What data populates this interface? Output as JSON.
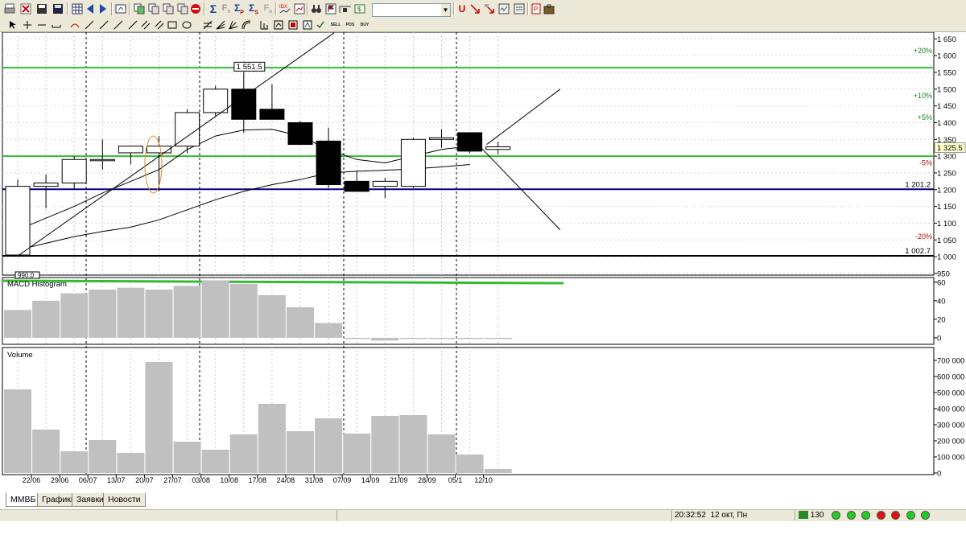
{
  "toolbar": {
    "icons": [
      "print-icon",
      "stop-icon",
      "save-icon",
      "chart-icon",
      "back-icon",
      "forward-icon",
      "refresh-icon",
      "copy-icon",
      "copy2-icon",
      "copy3-icon",
      "copy4-icon",
      "stop-sign-icon",
      "sum-icon",
      "fx-icon",
      "sigma-p-icon",
      "sigma-s-icon",
      "fa-icon",
      "index-icon",
      "chart2-icon",
      "binoculars-icon",
      "flag-icon",
      "tick-icon",
      "usd-icon",
      "arrow-icon",
      "report-icon",
      "book-icon",
      "briefcase-icon"
    ],
    "combo_value": "",
    "tools": [
      "cursor-icon",
      "crosshair-icon",
      "hline-icon",
      "line-icon",
      "ray-icon",
      "trend-icon",
      "channel-icon",
      "rect-icon",
      "ellipse-icon",
      "text-icon",
      "fib-icon",
      "fan-icon",
      "arc-icon",
      "time-icon",
      "zoom-icon",
      "buy-icon",
      "sell-icon",
      "sell-tag",
      "pos-tag",
      "av-tag"
    ],
    "tag_sell": "SELL",
    "tag_pos": "POS",
    "tag_buy": "BUY"
  },
  "colors": {
    "green": "#33bb33",
    "navy": "#000080",
    "panel_bg": "#ece9d8",
    "bar_gray": "#c0c0c0"
  },
  "chart_data": [
    {
      "type": "candlestick",
      "title": "",
      "categories": [
        "22/06",
        "29/06",
        "06/07",
        "13/07",
        "20/07",
        "27/07",
        "03/08",
        "10/08",
        "17/08",
        "24/08",
        "31/08",
        "07/09",
        "14/09",
        "21/09",
        "28/09",
        "05/10",
        "12/10",
        "",
        "",
        ""
      ],
      "x_tick_labels": [
        "22/06",
        "29/06",
        "06/07",
        "13/07",
        "20/07",
        "27/07",
        "03/08",
        "10/08",
        "17/08",
        "24/08",
        "31/08",
        "07/09",
        "14/09",
        "21/09",
        "28/09",
        "05/1",
        "12/10"
      ],
      "candles": [
        {
          "o": 1005,
          "h": 1230,
          "l": 1005,
          "c": 1210
        },
        {
          "o": 1210,
          "h": 1245,
          "l": 1145,
          "c": 1220
        },
        {
          "o": 1220,
          "h": 1300,
          "l": 1200,
          "c": 1290
        },
        {
          "o": 1290,
          "h": 1350,
          "l": 1260,
          "c": 1290
        },
        {
          "o": 1310,
          "h": 1330,
          "l": 1275,
          "c": 1330
        },
        {
          "o": 1310,
          "h": 1360,
          "l": 1195,
          "c": 1330
        },
        {
          "o": 1330,
          "h": 1440,
          "l": 1310,
          "c": 1430
        },
        {
          "o": 1430,
          "h": 1510,
          "l": 1420,
          "c": 1500
        },
        {
          "o": 1500,
          "h": 1551.5,
          "l": 1370,
          "c": 1410
        },
        {
          "o": 1440,
          "h": 1515,
          "l": 1410,
          "c": 1410
        },
        {
          "o": 1400,
          "h": 1405,
          "l": 1340,
          "c": 1335
        },
        {
          "o": 1345,
          "h": 1385,
          "l": 1205,
          "c": 1215
        },
        {
          "o": 1225,
          "h": 1255,
          "l": 1195,
          "c": 1195
        },
        {
          "o": 1210,
          "h": 1235,
          "l": 1175,
          "c": 1225
        },
        {
          "o": 1210,
          "h": 1355,
          "l": 1205,
          "c": 1350
        },
        {
          "o": 1350,
          "h": 1380,
          "l": 1325,
          "c": 1355
        },
        {
          "o": 1370,
          "h": 1370,
          "l": 1310,
          "c": 1315
        },
        {
          "o": 1320,
          "h": 1342,
          "l": 1305,
          "c": 1328
        }
      ],
      "y_ticks": [
        "1 650",
        "1 600",
        "1 550",
        "1 500",
        "1 450",
        "1 400",
        "1 350",
        "1 300",
        "1 250",
        "1 200",
        "1 150",
        "1 100",
        "1 050",
        "1 000",
        "950"
      ],
      "y_tick_values": [
        1650,
        1600,
        1550,
        1500,
        1450,
        1400,
        1350,
        1300,
        1250,
        1200,
        1150,
        1100,
        1050,
        1000,
        950
      ],
      "ylim": [
        945,
        1670
      ],
      "last_price": "1 325.5",
      "high_label": "1 551.5",
      "low_label": "990.0",
      "hlines": [
        {
          "value": 1564,
          "color": "green"
        },
        {
          "value": 1300,
          "color": "green"
        },
        {
          "value": 1201.2,
          "color": "navy",
          "label": "1 201.2"
        },
        {
          "value": 1002.7,
          "color": "black",
          "label": "1 002.7"
        }
      ],
      "pct_labels": [
        {
          "text": "+20%",
          "value": 1615
        },
        {
          "text": "+10%",
          "value": 1480
        },
        {
          "text": "+5%",
          "value": 1415
        },
        {
          "text": "-5%",
          "value": 1280
        },
        {
          "text": "-20%",
          "value": 1060
        }
      ],
      "ma_fast": [
        1080,
        1115,
        1150,
        1190,
        1225,
        1260,
        1320,
        1360,
        1378,
        1380,
        1360,
        1320,
        1290,
        1280,
        1300,
        1320,
        1330
      ],
      "ma_slow": [
        1020,
        1040,
        1060,
        1075,
        1088,
        1110,
        1140,
        1170,
        1195,
        1215,
        1230,
        1250,
        1255,
        1258,
        1262,
        1268,
        1275
      ],
      "trendline_up": [
        [
          0,
          1002
        ],
        [
          11.2,
          1668
        ]
      ],
      "projection_up": [
        [
          16.6,
          1335
        ],
        [
          19.2,
          1500
        ]
      ],
      "projection_down": [
        [
          16.4,
          1325
        ],
        [
          19.2,
          1080
        ]
      ],
      "annotation_ellipse_x": [
        4.5,
        5.1
      ],
      "annotation_ellipse_y": [
        1190,
        1360
      ]
    },
    {
      "type": "bar",
      "title": "MACD Histogram",
      "categories": [
        "22/06",
        "29/06",
        "06/07",
        "13/07",
        "20/07",
        "27/07",
        "03/08",
        "10/08",
        "17/08",
        "24/08",
        "31/08",
        "07/09",
        "14/09",
        "21/09",
        "28/09",
        "05/10",
        "12/10"
      ],
      "values": [
        30,
        40,
        48,
        52,
        54,
        52,
        56,
        62,
        58,
        46,
        33,
        16,
        -1,
        -3,
        -1,
        0,
        -1,
        -1
      ],
      "y_ticks": [
        "60",
        "40",
        "20",
        "0"
      ],
      "y_tick_values": [
        60,
        40,
        20,
        0
      ],
      "ylim": [
        -7,
        65
      ]
    },
    {
      "type": "bar",
      "title": "Volume",
      "categories": [
        "22/06",
        "29/06",
        "06/07",
        "13/07",
        "20/07",
        "27/07",
        "03/08",
        "10/08",
        "17/08",
        "24/08",
        "31/08",
        "07/09",
        "14/09",
        "21/09",
        "28/09",
        "05/10",
        "12/10"
      ],
      "values": [
        520000,
        270000,
        135000,
        205000,
        125000,
        690000,
        195000,
        145000,
        240000,
        430000,
        260000,
        340000,
        245000,
        355000,
        360000,
        240000,
        115000,
        25000
      ],
      "y_ticks": [
        "700 000",
        "600 000",
        "500 000",
        "400 000",
        "300 000",
        "200 000",
        "100 000",
        "0"
      ],
      "y_tick_values": [
        700000,
        600000,
        500000,
        400000,
        300000,
        200000,
        100000,
        0
      ],
      "ylim": [
        -10000,
        780000
      ]
    }
  ],
  "tabs": [
    {
      "label": "ММВБ",
      "active": true
    },
    {
      "label": "Графики",
      "active": false
    },
    {
      "label": "Заявки",
      "active": false
    },
    {
      "label": "Новости",
      "active": false
    }
  ],
  "status": {
    "time": "20:32:52",
    "date": "12 окт, Пн",
    "count": "130",
    "leds": [
      "#22cc22",
      "#22cc22",
      "#22cc22",
      "#dd1111",
      "#dd1111",
      "#22cc22",
      "#22cc22"
    ]
  }
}
